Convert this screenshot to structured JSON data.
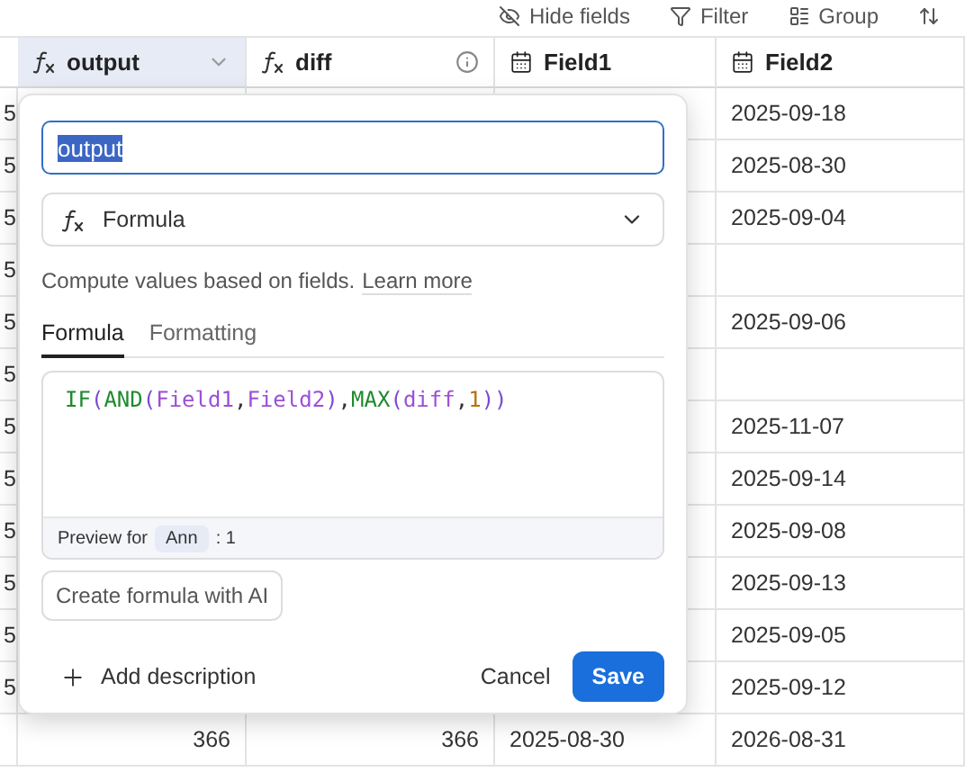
{
  "toolbar": [
    {
      "label": "Hide fields"
    },
    {
      "label": "Filter"
    },
    {
      "label": "Group"
    }
  ],
  "columns": [
    {
      "label": "output",
      "kind": "formula",
      "selected": true
    },
    {
      "label": "diff",
      "kind": "formula",
      "selected": false
    },
    {
      "label": "Field1",
      "kind": "date",
      "selected": false
    },
    {
      "label": "Field2",
      "kind": "date",
      "selected": false
    }
  ],
  "rows": [
    {
      "column_0": "5",
      "field2": "2025-09-18"
    },
    {
      "column_0": "5",
      "field2": "2025-08-30"
    },
    {
      "column_0": "5",
      "field2": "2025-09-04"
    },
    {
      "column_0": "5"
    },
    {
      "column_0": "5",
      "field2": "2025-09-06"
    },
    {
      "column_0": "5"
    },
    {
      "column_0": "5",
      "field2": "2025-11-07"
    },
    {
      "column_0": "5",
      "field2": "2025-09-14"
    },
    {
      "column_0": "5",
      "field2": "2025-09-08"
    },
    {
      "column_0": "5",
      "field2": "2025-09-13"
    },
    {
      "column_0": "5",
      "field2": "2025-09-05"
    },
    {
      "column_0": "5",
      "field2": "2025-09-12"
    },
    {
      "output": "366",
      "diff": "366",
      "field1": "2025-08-30",
      "field2": "2026-08-31"
    }
  ],
  "dialog": {
    "name_value": "output",
    "type": "Formula",
    "description": "Compute values based on fields.",
    "learn_more": "Learn more",
    "tabs": [
      {
        "label": "Formula",
        "selected": true
      },
      {
        "label": "Formatting",
        "selected": false
      }
    ],
    "formula": [
      {
        "text": "IF",
        "kind": "function"
      },
      {
        "text": "(",
        "kind": "paren"
      },
      {
        "text": "AND",
        "kind": "function"
      },
      {
        "text": "(",
        "kind": "paren"
      },
      {
        "text": "Field1",
        "kind": "field"
      },
      {
        "text": ",",
        "kind": "plain"
      },
      {
        "text": "Field2",
        "kind": "field"
      },
      {
        "text": ")",
        "kind": "paren"
      },
      {
        "text": ",",
        "kind": "plain"
      },
      {
        "text": "MAX",
        "kind": "function"
      },
      {
        "text": "(",
        "kind": "paren"
      },
      {
        "text": "diff",
        "kind": "field"
      },
      {
        "text": ",",
        "kind": "plain"
      },
      {
        "text": "1",
        "kind": "number"
      },
      {
        "text": "))",
        "kind": "paren"
      }
    ],
    "preview_label": "Preview for",
    "preview_record": "Ann",
    "preview_value": ": 1",
    "ai_button": "Create formula with AI",
    "add_description": "Add description",
    "cancel": "Cancel",
    "save": "Save"
  }
}
